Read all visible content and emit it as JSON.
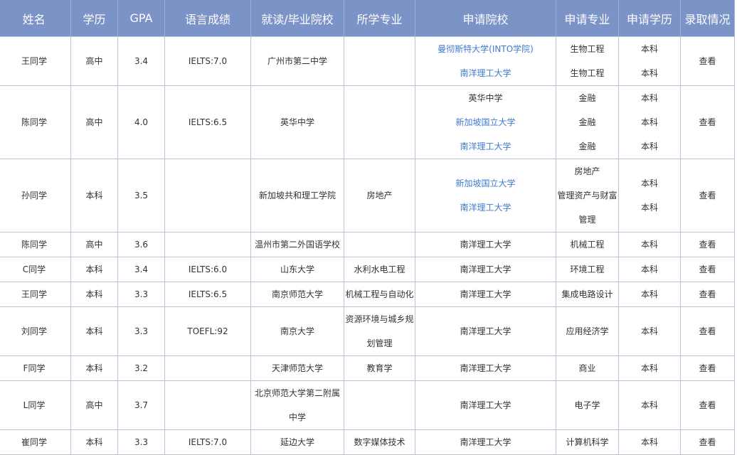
{
  "headers": [
    "姓名",
    "学历",
    "GPA",
    "语言成绩",
    "就读/毕业院校",
    "所学专业",
    "申请院校",
    "申请专业",
    "申请学历",
    "录取情况"
  ],
  "rows": [
    {
      "name": "王同学",
      "edu": "高中",
      "gpa": "3.4",
      "lang": "IELTS:7.0",
      "school": "广州市第二中学",
      "major": "",
      "apps": [
        {
          "school": "曼彻斯特大学(INTO学院)",
          "major": "生物工程",
          "degree": "本科"
        },
        {
          "school": "南洋理工大学",
          "major": "生物工程",
          "degree": "本科"
        }
      ],
      "result": "查看"
    },
    {
      "name": "陈同学",
      "edu": "高中",
      "gpa": "4.0",
      "lang": "IELTS:6.5",
      "school": "英华中学",
      "major": "",
      "apps": [
        {
          "school": "英华中学",
          "major": "金融",
          "degree": "本科"
        },
        {
          "school": "新加坡国立大学",
          "major": "金融",
          "degree": "本科"
        },
        {
          "school": "南洋理工大学",
          "major": "金融",
          "degree": "本科"
        }
      ],
      "result": "查看"
    },
    {
      "name": "孙同学",
      "edu": "本科",
      "gpa": "3.5",
      "lang": "",
      "school": "新加坡共和理工学院",
      "major": "房地产",
      "apps": [
        {
          "school": "新加坡国立大学",
          "major": "房地产",
          "degree": "本科"
        },
        {
          "school": "南洋理工大学",
          "major": "管理资产与财富管理",
          "degree": "本科"
        }
      ],
      "result": "查看"
    },
    {
      "name": "陈同学",
      "edu": "高中",
      "gpa": "3.6",
      "lang": "",
      "school": "温州市第二外国语学校",
      "major": "",
      "apps": [
        {
          "school": "南洋理工大学",
          "major": "机械工程",
          "degree": "本科"
        }
      ],
      "result": "查看"
    },
    {
      "name": "C同学",
      "edu": "本科",
      "gpa": "3.4",
      "lang": "IELTS:6.0",
      "school": "山东大学",
      "major": "水利水电工程",
      "apps": [
        {
          "school": "南洋理工大学",
          "major": "环境工程",
          "degree": "本科"
        }
      ],
      "result": "查看"
    },
    {
      "name": "王同学",
      "edu": "本科",
      "gpa": "3.3",
      "lang": "IELTS:6.5",
      "school": "南京师范大学",
      "major": "机械工程与自动化",
      "apps": [
        {
          "school": "南洋理工大学",
          "major": "集成电路设计",
          "degree": "本科"
        }
      ],
      "result": "查看"
    },
    {
      "name": "刘同学",
      "edu": "本科",
      "gpa": "3.3",
      "lang": "TOEFL:92",
      "school": "南京大学",
      "major": "资源环境与城乡规划管理",
      "apps": [
        {
          "school": "南洋理工大学",
          "major": "应用经济学",
          "degree": "本科"
        }
      ],
      "result": "查看"
    },
    {
      "name": "F同学",
      "edu": "本科",
      "gpa": "3.2",
      "lang": "",
      "school": "天津师范大学",
      "major": "教育学",
      "apps": [
        {
          "school": "南洋理工大学",
          "major": "商业",
          "degree": "本科"
        }
      ],
      "result": "查看"
    },
    {
      "name": "L同学",
      "edu": "高中",
      "gpa": "3.7",
      "lang": "",
      "school": "北京师范大学第二附属中学",
      "major": "",
      "apps": [
        {
          "school": "南洋理工大学",
          "major": "电子学",
          "degree": "本科"
        }
      ],
      "result": "查看"
    },
    {
      "name": "崔同学",
      "edu": "本科",
      "gpa": "3.3",
      "lang": "IELTS:7.0",
      "school": "延边大学",
      "major": "数字媒体技术",
      "apps": [
        {
          "school": "南洋理工大学",
          "major": "计算机科学",
          "degree": "本科"
        }
      ],
      "result": "查看"
    }
  ]
}
